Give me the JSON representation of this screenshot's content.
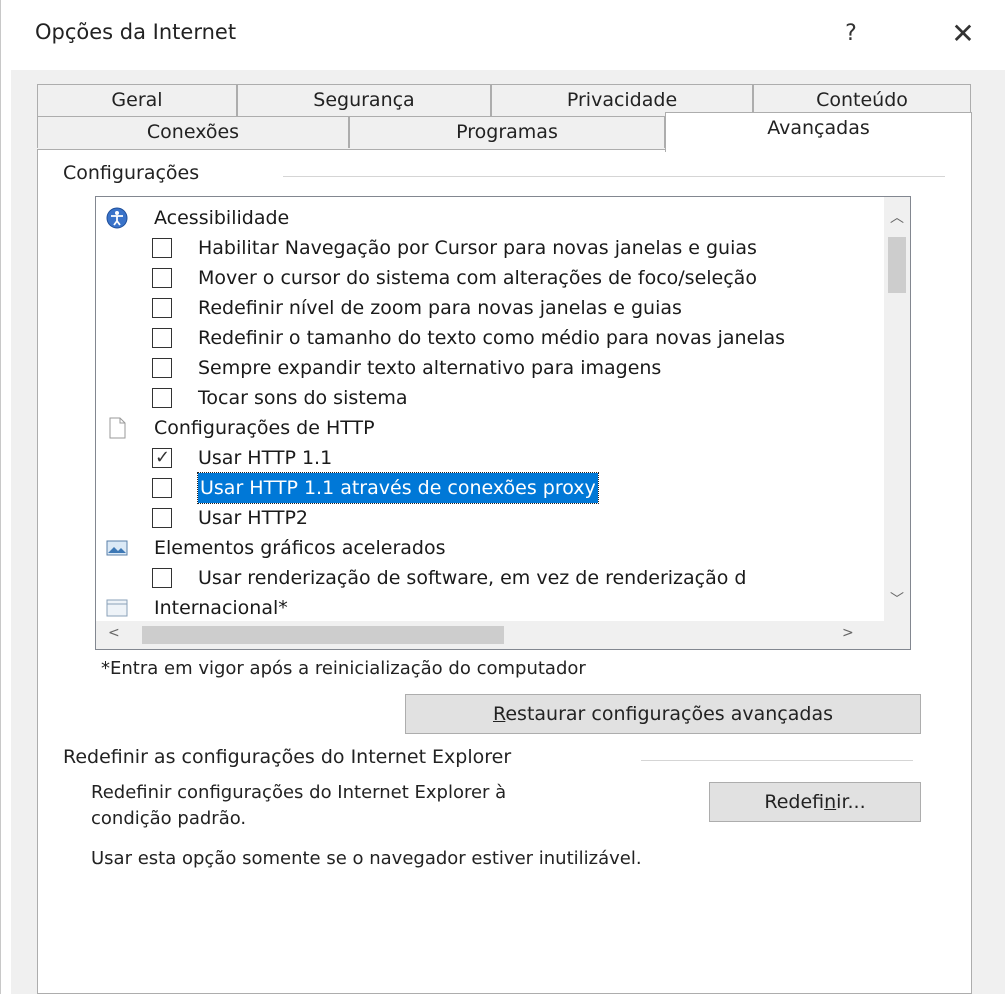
{
  "window": {
    "title": "Opções da Internet",
    "help_label": "?",
    "close_label": "✕"
  },
  "tabs": {
    "row1": [
      "Geral",
      "Segurança",
      "Privacidade",
      "Conteúdo"
    ],
    "row2": [
      "Conexões",
      "Programas",
      "Avançadas"
    ],
    "active": "Avançadas"
  },
  "settings": {
    "group_label": "Configurações",
    "items": [
      {
        "type": "category",
        "icon": "accessibility-icon",
        "label": "Acessibilidade"
      },
      {
        "type": "checkbox",
        "checked": false,
        "label": "Habilitar Navegação por Cursor para novas janelas e guias"
      },
      {
        "type": "checkbox",
        "checked": false,
        "label": "Mover o cursor do sistema com alterações de foco/seleção"
      },
      {
        "type": "checkbox",
        "checked": false,
        "label": "Redefinir nível de zoom para novas janelas e guias"
      },
      {
        "type": "checkbox",
        "checked": false,
        "label": "Redefinir o tamanho do texto como médio para novas janelas"
      },
      {
        "type": "checkbox",
        "checked": false,
        "label": "Sempre expandir texto alternativo para imagens"
      },
      {
        "type": "checkbox",
        "checked": false,
        "label": "Tocar sons do sistema"
      },
      {
        "type": "category",
        "icon": "page-icon",
        "label": "Configurações de HTTP"
      },
      {
        "type": "checkbox",
        "checked": true,
        "label": "Usar HTTP 1.1"
      },
      {
        "type": "checkbox",
        "checked": false,
        "selected": true,
        "label": "Usar HTTP 1.1 através de conexões proxy"
      },
      {
        "type": "checkbox",
        "checked": false,
        "label": "Usar HTTP2"
      },
      {
        "type": "category",
        "icon": "graphics-icon",
        "label": "Elementos gráficos acelerados"
      },
      {
        "type": "checkbox",
        "checked": false,
        "label": "Usar renderização de software, em vez de renderização d"
      },
      {
        "type": "category",
        "icon": "international-icon",
        "label": "Internacional*"
      }
    ],
    "note": "*Entra em vigor após a reinicialização do computador",
    "restore_button": {
      "accel": "R",
      "rest": "estaurar configurações avançadas"
    }
  },
  "reset": {
    "group_label": "Redefinir as configurações do Internet Explorer",
    "description_line1": "Redefinir configurações do Internet Explorer à",
    "description_line2": "condição padrão.",
    "button": {
      "before": "Redefi",
      "accel": "n",
      "after": "ir..."
    },
    "warning": "Usar esta opção somente se o navegador estiver inutilizável."
  },
  "colors": {
    "selection": "#0078d7",
    "dialog_bg": "#f0f0f0",
    "panel_bg": "#ffffff"
  }
}
